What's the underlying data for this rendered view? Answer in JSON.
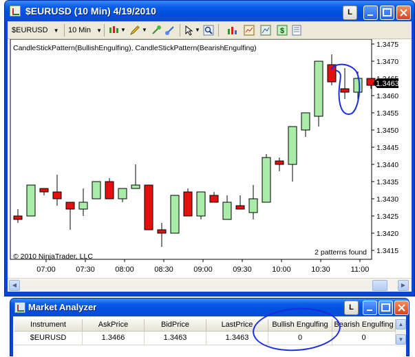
{
  "chart_window": {
    "title": "$EURUSD (10 Min)  4/19/2010",
    "l_button": "L",
    "toolbar": {
      "instrument": "$EURUSD",
      "interval": "10 Min"
    }
  },
  "chart": {
    "indicator_label": "CandleStickPattern(BullishEngulfing), CandleStickPattern(BearishEngulfing)",
    "copyright": "© 2010 NinjaTrader, LLC",
    "patterns_found": "2 patterns found",
    "last_price_tag": "1.3463",
    "price_labels": [
      "1.3475",
      "1.3470",
      "1.3465",
      "1.3460",
      "1.3455",
      "1.3450",
      "1.3445",
      "1.3440",
      "1.3435",
      "1.3430",
      "1.3425",
      "1.3420",
      "1.3415"
    ],
    "time_labels": [
      "07:00",
      "07:30",
      "08:00",
      "08:30",
      "09:00",
      "09:30",
      "10:00",
      "10:30",
      "11:00"
    ]
  },
  "chart_data": {
    "type": "candlestick",
    "ylim": [
      1.3412,
      1.3478
    ],
    "up_color": "#a8eca8",
    "down_color": "#e41010",
    "candles": [
      {
        "o": 1.3425,
        "h": 1.3427,
        "l": 1.3423,
        "c": 1.3424
      },
      {
        "o": 1.3425,
        "h": 1.3434,
        "l": 1.3425,
        "c": 1.3434
      },
      {
        "o": 1.3433,
        "h": 1.3433,
        "l": 1.3431,
        "c": 1.3432
      },
      {
        "o": 1.3432,
        "h": 1.3437,
        "l": 1.3428,
        "c": 1.343
      },
      {
        "o": 1.3429,
        "h": 1.3429,
        "l": 1.3421,
        "c": 1.3427
      },
      {
        "o": 1.3427,
        "h": 1.3433,
        "l": 1.3425,
        "c": 1.3429
      },
      {
        "o": 1.343,
        "h": 1.3435,
        "l": 1.343,
        "c": 1.3435
      },
      {
        "o": 1.3435,
        "h": 1.3436,
        "l": 1.343,
        "c": 1.343
      },
      {
        "o": 1.343,
        "h": 1.3433,
        "l": 1.3429,
        "c": 1.3433
      },
      {
        "o": 1.3433,
        "h": 1.344,
        "l": 1.3433,
        "c": 1.3434
      },
      {
        "o": 1.3434,
        "h": 1.3434,
        "l": 1.3421,
        "c": 1.3421
      },
      {
        "o": 1.3421,
        "h": 1.3423,
        "l": 1.3416,
        "c": 1.342
      },
      {
        "o": 1.342,
        "h": 1.3431,
        "l": 1.342,
        "c": 1.3431
      },
      {
        "o": 1.3432,
        "h": 1.3433,
        "l": 1.3425,
        "c": 1.3425
      },
      {
        "o": 1.3425,
        "h": 1.3432,
        "l": 1.3424,
        "c": 1.3432
      },
      {
        "o": 1.3431,
        "h": 1.3432,
        "l": 1.3429,
        "c": 1.3429
      },
      {
        "o": 1.3424,
        "h": 1.3431,
        "l": 1.3424,
        "c": 1.3429
      },
      {
        "o": 1.3428,
        "h": 1.3431,
        "l": 1.3427,
        "c": 1.3427
      },
      {
        "o": 1.3426,
        "h": 1.3434,
        "l": 1.3424,
        "c": 1.343
      },
      {
        "o": 1.3429,
        "h": 1.3443,
        "l": 1.3429,
        "c": 1.3442
      },
      {
        "o": 1.3441,
        "h": 1.3442,
        "l": 1.3438,
        "c": 1.344
      },
      {
        "o": 1.344,
        "h": 1.3451,
        "l": 1.3435,
        "c": 1.3451
      },
      {
        "o": 1.345,
        "h": 1.3455,
        "l": 1.3448,
        "c": 1.3455
      },
      {
        "o": 1.3454,
        "h": 1.347,
        "l": 1.3451,
        "c": 1.347
      },
      {
        "o": 1.3469,
        "h": 1.3472,
        "l": 1.3463,
        "c": 1.3464
      },
      {
        "o": 1.3462,
        "h": 1.3468,
        "l": 1.3459,
        "c": 1.3461
      },
      {
        "o": 1.3461,
        "h": 1.3467,
        "l": 1.3458,
        "c": 1.3465
      },
      {
        "o": 1.3465,
        "h": 1.3465,
        "l": 1.3462,
        "c": 1.3463
      }
    ]
  },
  "market_analyzer": {
    "title": "Market Analyzer",
    "l_button": "L",
    "columns": [
      "Instrument",
      "AskPrice",
      "BidPrice",
      "LastPrice",
      "Bullish Engulfing",
      "Bearish Engulfing"
    ],
    "row": [
      "$EURUSD",
      "1.3466",
      "1.3463",
      "1.3463",
      "0",
      "0"
    ]
  }
}
